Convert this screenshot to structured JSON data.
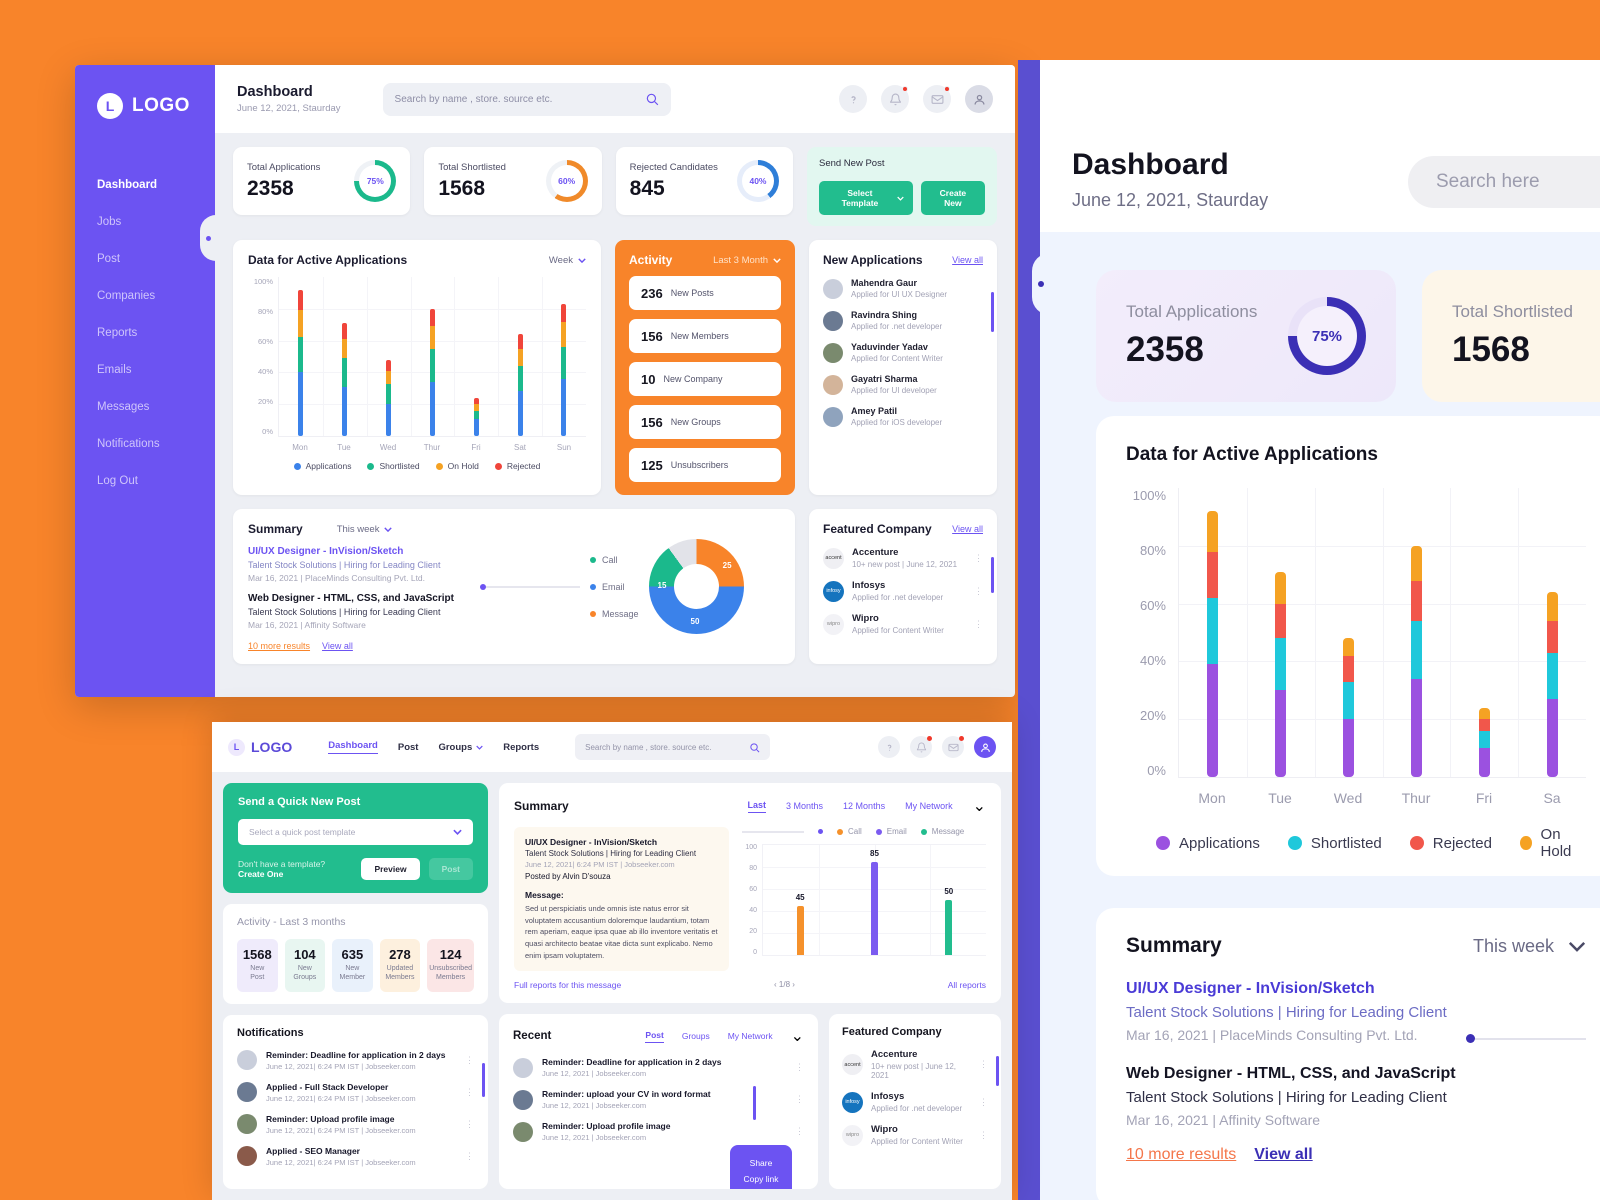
{
  "brand": {
    "logo_letter": "L",
    "logo_text": "LOGO",
    "primary": "#6C53F2",
    "orange": "#F8842A",
    "green": "#22BD8E"
  },
  "sidebar": {
    "items": [
      {
        "label": "Dashboard",
        "active": true
      },
      {
        "label": "Jobs",
        "active": false
      },
      {
        "label": "Post",
        "active": false
      },
      {
        "label": "Companies",
        "active": false
      },
      {
        "label": "Reports",
        "active": false
      },
      {
        "label": "Emails",
        "active": false
      },
      {
        "label": "Messages",
        "active": false
      },
      {
        "label": "Notifications",
        "active": false
      },
      {
        "label": "Log Out",
        "active": false
      }
    ]
  },
  "header": {
    "title": "Dashboard",
    "subtitle": "June 12, 2021, Staurday",
    "search_placeholder": "Search by name , store. source etc."
  },
  "stats": [
    {
      "label": "Total Applications",
      "value": "2358",
      "percent": "75%",
      "color": "#1BB98C"
    },
    {
      "label": "Total Shortlisted",
      "value": "1568",
      "percent": "60%",
      "color": "#F08A2A"
    },
    {
      "label": "Rejected Candidates",
      "value": "845",
      "percent": "40%",
      "color": "#2E7ED8"
    }
  ],
  "send_post": {
    "title": "Send New Post",
    "select_template_label": "Select Template",
    "create_new_label": "Create New"
  },
  "chart_data": [
    {
      "type": "bar",
      "title": "Data for Active Applications",
      "range_label": "Week",
      "categories": [
        "Mon",
        "Tue",
        "Wed",
        "Thur",
        "Fri",
        "Sat",
        "Sun"
      ],
      "series": [
        {
          "name": "Applications",
          "color": "#3B82EA",
          "values": [
            40,
            31,
            20,
            34,
            11,
            28,
            36
          ]
        },
        {
          "name": "Shortlisted",
          "color": "#1BB98C",
          "values": [
            22,
            18,
            13,
            21,
            5,
            16,
            20
          ]
        },
        {
          "name": "On Hold",
          "color": "#F5A223",
          "values": [
            17,
            12,
            8,
            14,
            4,
            11,
            16
          ]
        },
        {
          "name": "Rejected",
          "color": "#F0453A",
          "values": [
            13,
            10,
            7,
            11,
            4,
            9,
            11
          ]
        }
      ],
      "ylabel": "",
      "xlabel": "",
      "yticks": [
        "100%",
        "80%",
        "60%",
        "40%",
        "20%",
        "0%"
      ],
      "ylim": [
        0,
        100
      ],
      "grid": true,
      "legend_position": "bottom"
    },
    {
      "type": "pie",
      "title": "Summary donut",
      "labels": [
        "Message",
        "Email",
        "Call",
        "Remaining"
      ],
      "values": [
        25,
        50,
        15,
        10
      ],
      "colors": [
        "#F8842A",
        "#3B82EA",
        "#1BB98C",
        "#E2E3E9"
      ],
      "legend": [
        {
          "name": "Call",
          "color": "#1BB98C"
        },
        {
          "name": "Email",
          "color": "#3B82EA"
        },
        {
          "name": "Message",
          "color": "#F8842A"
        }
      ]
    },
    {
      "type": "bar",
      "title": "Data for Active Applications",
      "variant": "zoom-panel",
      "categories": [
        "Mon",
        "Tue",
        "Wed",
        "Thur",
        "Fri",
        "Sa"
      ],
      "series": [
        {
          "name": "Applications",
          "color": "#9B51E0",
          "values": [
            39,
            30,
            20,
            34,
            10,
            27
          ]
        },
        {
          "name": "Shortlisted",
          "color": "#1FC8DB",
          "values": [
            23,
            18,
            13,
            20,
            6,
            16
          ]
        },
        {
          "name": "Rejected",
          "color": "#F1574B",
          "values": [
            16,
            12,
            9,
            14,
            4,
            11
          ]
        },
        {
          "name": "On Hold",
          "color": "#F5A223",
          "values": [
            14,
            11,
            6,
            12,
            4,
            10
          ]
        }
      ],
      "yticks": [
        "100%",
        "80%",
        "60%",
        "40%",
        "20%",
        "0%"
      ],
      "ylim": [
        0,
        100
      ],
      "grid": true,
      "legend_position": "bottom"
    },
    {
      "type": "bar",
      "title": "Summary message stats",
      "categories": [
        "Call",
        "Email",
        "Message"
      ],
      "values": [
        45,
        85,
        50
      ],
      "colors": [
        "#F5912B",
        "#7B5BF0",
        "#22BD8E"
      ],
      "data_labels": [
        "45",
        "85",
        "50"
      ],
      "yticks": [
        "100",
        "80",
        "60",
        "40",
        "20",
        "0"
      ],
      "ylim": [
        0,
        100
      ]
    }
  ],
  "activity": {
    "title": "Activity",
    "range_label": "Last 3 Month",
    "rows": [
      {
        "count": "236",
        "label": "New Posts"
      },
      {
        "count": "156",
        "label": "New Members"
      },
      {
        "count": "10",
        "label": "New Company"
      },
      {
        "count": "156",
        "label": "New Groups"
      },
      {
        "count": "125",
        "label": "Unsubscribers"
      }
    ]
  },
  "new_applications": {
    "title": "New Applications",
    "view_all": "View all",
    "items": [
      {
        "name": "Mahendra Gaur",
        "sub": "Applied for UI UX Designer",
        "color": "#C9CEDB"
      },
      {
        "name": "Ravindra Shing",
        "sub": "Applied for .net developer",
        "color": "#6B7A92"
      },
      {
        "name": "Yaduvinder Yadav",
        "sub": "Applied for Content Writer",
        "color": "#7A8A6E"
      },
      {
        "name": "Gayatri Sharma",
        "sub": "Applied for UI developer",
        "color": "#D3B49A"
      },
      {
        "name": "Amey Patil",
        "sub": "Applied for iOS developer",
        "color": "#8FA3BD"
      }
    ]
  },
  "summary": {
    "title": "Summary",
    "range_label": "This week",
    "jobs": [
      {
        "title": "UI/UX Designer - InVision/Sketch",
        "meta": "Talent Stock Solutions  |  Hiring for Leading Client",
        "date": "Mar 16, 2021 | PlaceMinds Consulting Pvt. Ltd.",
        "highlight": true
      },
      {
        "title": "Web Designer - HTML, CSS, and JavaScript",
        "meta": "Talent Stock Solutions  |  Hiring for Leading Client",
        "date": "Mar 16, 2021 | Affinity Software",
        "highlight": false
      }
    ],
    "more_results": "10 more results",
    "view_all": "View all"
  },
  "featured_company": {
    "title": "Featured Company",
    "view_all": "View all",
    "items": [
      {
        "name": "Accenture",
        "sub": "10+ new post |  June 12, 2021",
        "logo": "accenture",
        "bg": "#EFEFF3",
        "fg": "#333"
      },
      {
        "name": "Infosys",
        "sub": "Applied for .net developer",
        "logo": "infosys",
        "bg": "#1574BE",
        "fg": "#fff"
      },
      {
        "name": "Wipro",
        "sub": "Applied for Content Writer",
        "logo": "wipro",
        "bg": "#F2F2F6",
        "fg": "#888"
      }
    ]
  },
  "zoom_panel": {
    "title": "Dashboard",
    "subtitle": "June 12, 2021, Staurday",
    "search_placeholder": "Search here",
    "cards": [
      {
        "label": "Total Applications",
        "value": "2358",
        "percent": "75%",
        "ring": "#3B2FB5"
      },
      {
        "label": "Total Shortlisted",
        "value": "1568",
        "percent": "",
        "ring": "#F08A2A"
      }
    ],
    "chart_title": "Data for Active Applications",
    "summary_title": "Summary",
    "summary_range": "This week",
    "more_results": "10 more results",
    "view_all": "View all"
  },
  "bottom_panel": {
    "nav": [
      {
        "label": "Dashboard",
        "active": true,
        "caret": false
      },
      {
        "label": "Post",
        "active": false,
        "caret": false
      },
      {
        "label": "Groups",
        "active": false,
        "caret": true
      },
      {
        "label": "Reports",
        "active": false,
        "caret": false
      }
    ],
    "search_placeholder": "Search by name , store. source etc.",
    "quick_post": {
      "title": "Send a Quick New Post",
      "select_placeholder": "Select a quick post template",
      "hint": "Don't have a template?",
      "hint_link": "Create One",
      "preview_label": "Preview",
      "post_label": "Post"
    },
    "activity": {
      "title": "Activity - ",
      "range": "Last 3 months",
      "stats": [
        {
          "n": "1568",
          "l": "New\nPost",
          "bg": "#EFEBFB"
        },
        {
          "n": "104",
          "l": "New\nGroups",
          "bg": "#E8F6F1"
        },
        {
          "n": "635",
          "l": "New\nMember",
          "bg": "#E9F1FB"
        },
        {
          "n": "278",
          "l": "Updated\nMembers",
          "bg": "#FDF0DE"
        },
        {
          "n": "124",
          "l": "Unsubscribed\nMembers",
          "bg": "#FBE6E6"
        }
      ]
    },
    "notifications": {
      "title": "Notifications",
      "items": [
        {
          "t": "Reminder: Deadline for application in 2 days",
          "s": "June 12, 2021|  6:24 PM IST  |  Jobseeker.com",
          "color": "#C9CEDB"
        },
        {
          "t": "Applied - Full Stack Developer",
          "s": "June 12, 2021|  6:24 PM IST  |  Jobseeker.com",
          "color": "#6B7A92"
        },
        {
          "t": "Reminder: Upload profile image",
          "s": "June 12, 2021|  6:24 PM IST  |  Jobseeker.com",
          "color": "#7A8A6E"
        },
        {
          "t": "Applied - SEO Manager",
          "s": "June 12, 2021|  6:24 PM IST  |  Jobseeker.com",
          "color": "#8A5A4A"
        }
      ]
    },
    "summary": {
      "title": "Summary",
      "tabs": [
        {
          "label": "Last",
          "active": true
        },
        {
          "label": "3 Months",
          "active": false
        },
        {
          "label": "12 Months",
          "active": false
        },
        {
          "label": "My Network",
          "active": false,
          "caret": true
        }
      ],
      "message_card": {
        "job_title": "UI/UX Designer - InVision/Sketch",
        "job_meta": "Talent Stock Solutions  |  Hiring for Leading Client",
        "job_date": "June 12, 2021|  6:24 PM IST  |  Jobseeker.com",
        "posted_by": "Posted by Alvin D'souza",
        "message_label": "Message:",
        "message_body": "Sed ut perspiciatis unde omnis iste natus error sit voluptatem accusantium doloremque laudantium, totam rem aperiam, eaque ipsa quae ab illo inventore veritatis et quasi architecto beatae vitae dicta sunt explicabo. Nemo enim ipsam voluptatem."
      },
      "pager": "1/8",
      "legend": [
        {
          "name": "Call",
          "color": "#F5912B"
        },
        {
          "name": "Email",
          "color": "#7B5BF0"
        },
        {
          "name": "Message",
          "color": "#22BD8E"
        }
      ],
      "footer_left": "Full reports for this message",
      "footer_right": "All reports"
    },
    "recent": {
      "title": "Recent",
      "tabs": [
        {
          "label": "Post",
          "active": true
        },
        {
          "label": "Groups",
          "active": false
        },
        {
          "label": "My Network",
          "active": false,
          "caret": true
        }
      ],
      "items": [
        {
          "t": "Reminder: Deadline for application in 2 days",
          "s": "June 12, 2021  |  Jobseeker.com",
          "color": "#C9CEDB"
        },
        {
          "t": "Reminder: upload your CV in word format",
          "s": "June 12, 2021  |  Jobseeker.com",
          "color": "#6B7A92"
        },
        {
          "t": "Reminder: Upload profile image",
          "s": "June 12, 2021  |  Jobseeker.com",
          "color": "#7A8A6E"
        }
      ],
      "share_menu": [
        "Share",
        "Copy link"
      ]
    },
    "featured": {
      "title": "Featured Company",
      "items": [
        {
          "name": "Accenture",
          "sub": "10+ new post |  June 12, 2021",
          "bg": "#EFEFF3",
          "fg": "#333"
        },
        {
          "name": "Infosys",
          "sub": "Applied for .net developer",
          "bg": "#1574BE",
          "fg": "#fff"
        },
        {
          "name": "Wipro",
          "sub": "Applied for Content Writer",
          "bg": "#F2F2F6",
          "fg": "#888"
        }
      ]
    }
  }
}
